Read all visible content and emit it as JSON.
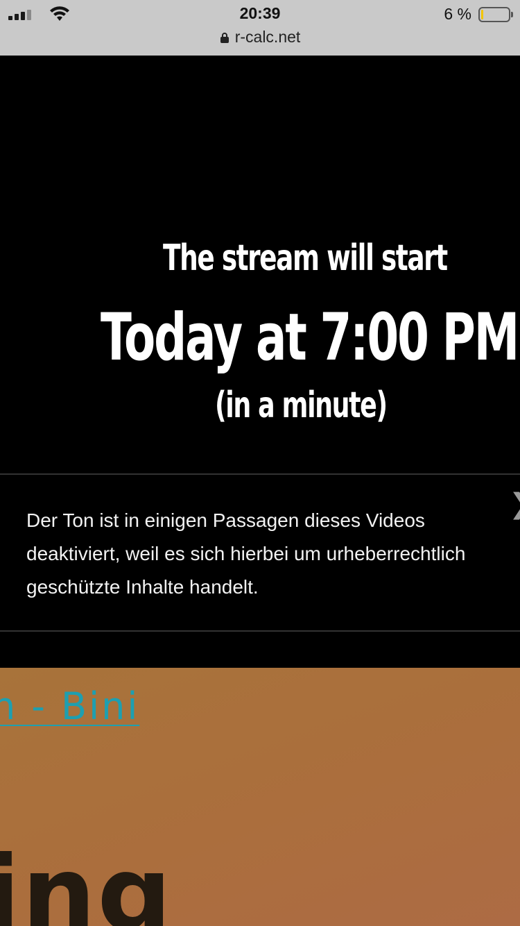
{
  "status_bar": {
    "time": "20:39",
    "battery_percent_label": "6 %",
    "battery_level_fraction": 0.06,
    "url": "r-calc.net",
    "signal_bars_active": 3,
    "signal_bars_total": 4
  },
  "video": {
    "stream_title": "The stream will start",
    "stream_time": "Today at 7:00 PM",
    "stream_relative": "(in a minute)",
    "notice": {
      "text": "Der Ton ist in einigen Passagen dieses Videos deaktiviert, weil es sich hierbei um urheberrechtlich geschützte Inhalte handelt.",
      "close_glyph": "❯"
    }
  },
  "page": {
    "link_text": "n - Bini",
    "heading_text": "ing"
  }
}
